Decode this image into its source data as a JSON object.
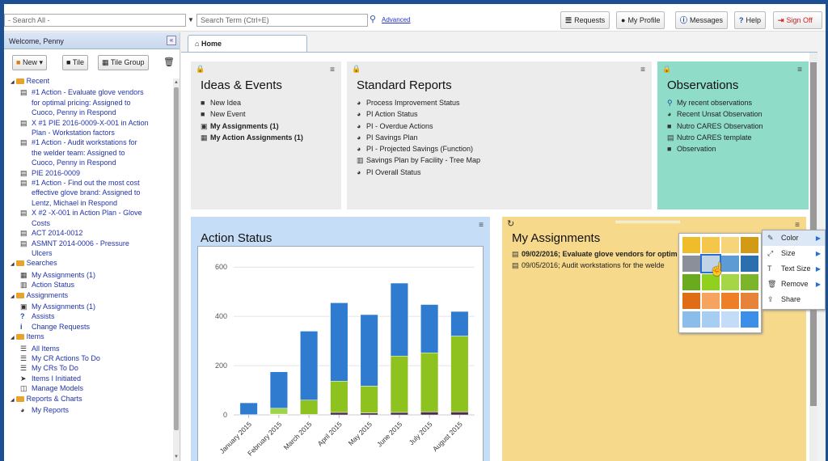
{
  "search": {
    "scope": "- Search All -",
    "placeholder": "Search Term (Ctrl+E)",
    "advanced": "Advanced"
  },
  "topnav": {
    "requests": "Requests",
    "profile": "My Profile",
    "messages": "Messages",
    "help": "Help",
    "signoff": "Sign Off"
  },
  "sidebar": {
    "welcome": "Welcome, Penny",
    "collapse": "«",
    "new": "New",
    "tile": "Tile",
    "tile_group": "Tile Group",
    "sections": [
      {
        "label": "Recent",
        "items": [
          {
            "icon": "doc",
            "lines": [
              "#1 Action - Evaluate glove vendors",
              "for optimal pricing: Assigned to",
              "Cuoco, Penny in Respond"
            ]
          },
          {
            "icon": "doc",
            "lines": [
              "X #1 PIE 2016-0009-X-001 in Action",
              "Plan - Workstation factors"
            ]
          },
          {
            "icon": "doc",
            "lines": [
              "#1 Action - Audit workstations for",
              "the welder team: Assigned to",
              "Cuoco, Penny in Respond"
            ]
          },
          {
            "icon": "doc",
            "lines": [
              "PIE 2016-0009"
            ]
          },
          {
            "icon": "doc",
            "lines": [
              "#1 Action - Find out the most cost",
              "effective glove brand: Assigned to",
              "Lentz, Michael in Respond"
            ]
          },
          {
            "icon": "doc",
            "lines": [
              "X #2 -X-001 in Action Plan - Glove",
              "Costs"
            ]
          },
          {
            "icon": "doc",
            "lines": [
              "ACT 2014-0012"
            ]
          },
          {
            "icon": "doc",
            "lines": [
              "ASMNT 2014-0006 - Pressure",
              "Ulcers"
            ]
          }
        ]
      },
      {
        "label": "Searches",
        "items": [
          {
            "icon": "table",
            "lines": [
              "My Assignments (1)"
            ]
          },
          {
            "icon": "chart",
            "lines": [
              "Action Status"
            ]
          }
        ]
      },
      {
        "label": "Assignments",
        "items": [
          {
            "icon": "clip",
            "lines": [
              "My Assignments (1)"
            ]
          },
          {
            "icon": "q",
            "lines": [
              "Assists"
            ]
          },
          {
            "icon": "i",
            "lines": [
              "Change Requests"
            ]
          }
        ]
      },
      {
        "label": "Items",
        "items": [
          {
            "icon": "list",
            "lines": [
              "All Items"
            ]
          },
          {
            "icon": "list",
            "lines": [
              "My CR Actions To Do"
            ]
          },
          {
            "icon": "list",
            "lines": [
              "My CRs To Do"
            ]
          },
          {
            "icon": "play",
            "lines": [
              "Items I Initiated"
            ]
          },
          {
            "icon": "model",
            "lines": [
              "Manage Models"
            ]
          }
        ]
      },
      {
        "label": "Reports & Charts",
        "items": [
          {
            "icon": "pie",
            "lines": [
              "My Reports"
            ]
          }
        ]
      }
    ]
  },
  "tabs": {
    "home": "Home"
  },
  "tiles": {
    "ideas": {
      "title": "Ideas & Events",
      "items": [
        {
          "icon": "new",
          "label": "New Idea",
          "bold": false
        },
        {
          "icon": "new",
          "label": "New Event",
          "bold": false
        },
        {
          "icon": "clip",
          "label": "My Assignments (1)",
          "bold": true
        },
        {
          "icon": "table",
          "label": "My Action Assignments (1)",
          "bold": true
        }
      ]
    },
    "reports": {
      "title": "Standard Reports",
      "items": [
        {
          "icon": "pie",
          "label": "Process Improvement Status"
        },
        {
          "icon": "pie",
          "label": "PI Action Status"
        },
        {
          "icon": "pie",
          "label": "PI - Overdue Actions"
        },
        {
          "icon": "pie",
          "label": "PI Savings Plan"
        },
        {
          "icon": "pie",
          "label": "PI - Projected Savings (Function)"
        },
        {
          "icon": "chart",
          "label": "Savings Plan by Facility - Tree Map"
        },
        {
          "icon": "pie",
          "label": "PI Overall Status"
        }
      ]
    },
    "observations": {
      "title": "Observations",
      "items": [
        {
          "icon": "search",
          "label": "My recent observations"
        },
        {
          "icon": "pie",
          "label": "Recent Unsat Observation"
        },
        {
          "icon": "new",
          "label": "Nutro CARES Observation"
        },
        {
          "icon": "doc",
          "label": "Nutro CARES template"
        },
        {
          "icon": "new",
          "label": "Observation"
        }
      ]
    },
    "action_status": {
      "title": "Action Status"
    },
    "my_assignments": {
      "title": "My Assignments",
      "items": [
        "09/02/2016; Evaluate glove vendors for optim",
        "09/05/2016; Audit workstations for the welde"
      ]
    }
  },
  "colors": {
    "ideas_bg": "#ececec",
    "reports_bg": "#ececec",
    "observations_bg": "#8fdcc8",
    "action_status_bg": "#c6ddf7",
    "my_assignments_bg": "#f6d98a",
    "swatches": [
      "#f0bd2a",
      "#f4c74a",
      "#f6d47a",
      "#d39a15",
      "#8a8f99",
      "#c0d4e6",
      "#5d9bd4",
      "#2c6fae",
      "#6aaa1f",
      "#8fd11c",
      "#a5d645",
      "#7cb42a",
      "#e06d16",
      "#f5a35f",
      "#ee7f26",
      "#e7823a",
      "#8bbdea",
      "#a5cef2",
      "#c3dcf7",
      "#3c8ee8"
    ]
  },
  "context_menu": {
    "items": [
      {
        "label": "Color",
        "icon": "pen",
        "arrow": true
      },
      {
        "label": "Size",
        "icon": "resize",
        "arrow": true
      },
      {
        "label": "Text Size",
        "icon": "textsize",
        "arrow": true
      },
      {
        "label": "Remove",
        "icon": "trash",
        "arrow": true
      },
      {
        "label": "Share",
        "icon": "share",
        "arrow": false
      }
    ]
  },
  "chart_data": {
    "type": "bar",
    "title": "Action Status",
    "categories": [
      "January 2015",
      "February 2015",
      "March 2015",
      "April 2015",
      "May 2015",
      "June 2015",
      "July 2015",
      "August 2015"
    ],
    "series": [
      {
        "values": [
          1,
          1,
          2,
          10,
          8,
          10,
          12,
          12
        ],
        "color": "#4a2a4f"
      },
      {
        "values": [
          0,
          2,
          58,
          127,
          109,
          229,
          240,
          308
        ],
        "color": "#8dc21f"
      },
      {
        "values": [
          0,
          24,
          0,
          0,
          0,
          0,
          0,
          0
        ],
        "color": "#9fd34a"
      },
      {
        "values": [
          48,
          148,
          280,
          318,
          290,
          296,
          196,
          100
        ],
        "color": "#2e7bd0"
      }
    ],
    "yticks": [
      0,
      200,
      400,
      600
    ],
    "ylim": [
      0,
      650
    ],
    "stacked": true,
    "grid": true
  }
}
